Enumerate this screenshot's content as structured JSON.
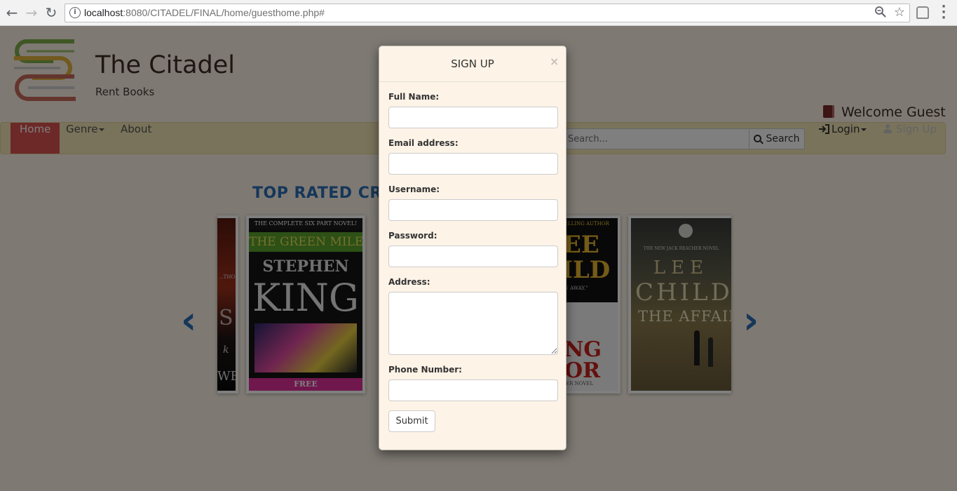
{
  "browser": {
    "url_host": "localhost",
    "url_rest": ":8080/CITADEL/FINAL/home/guesthome.php#",
    "back": "←",
    "forward": "→",
    "reload": "↻",
    "zoom_icon": "magnifier-icon",
    "star_icon": "☆"
  },
  "site": {
    "title": "The Citadel",
    "subtitle": "Rent Books",
    "welcome": "Welcome Guest"
  },
  "navbar": {
    "home": "Home",
    "genre": "Genre",
    "about": "About",
    "search_placeholder": "Search...",
    "search_button": "Search",
    "login": "Login",
    "signup": "Sign Up"
  },
  "carousel": {
    "title": "TOP RATED CRI",
    "prev": "‹",
    "next": "›",
    "books": [
      {
        "line1": "...THOR",
        "line2": "S",
        "line3": "k",
        "line4": "WE"
      },
      {
        "line1": "THE COMPLETE SIX PART NOVEL!",
        "line2": "THE GREEN MILE",
        "line3": "STEPHEN",
        "line4": "KING",
        "line5": "FREE"
      },
      {
        "line1": "ELLING AUTHOR",
        "line2": "EE",
        "line3": "ILD",
        "line4": "U AWAY.\"",
        "line5": "NG",
        "line6": "OR",
        "line7": "ER NOVEL"
      },
      {
        "line1": "THE NEW JACK REACHER NOVEL",
        "line2": "LEE",
        "line3": "CHILD",
        "line4": "THE AFFAIR"
      }
    ]
  },
  "modal": {
    "title": "SIGN UP",
    "close": "×",
    "fields": {
      "full_name": "Full Name:",
      "email": "Email address:",
      "username": "Username:",
      "password": "Password:",
      "address": "Address:",
      "phone": "Phone Number:"
    },
    "values": {
      "full_name": "",
      "email": "",
      "username": "",
      "password": "",
      "address": "",
      "phone": ""
    },
    "submit": "Submit"
  },
  "colors": {
    "nav_active": "#d9534f",
    "accent_blue": "#2a6fb5",
    "page_bg": "#fdf3e7",
    "navbar_bg": "#f4e7b6"
  }
}
